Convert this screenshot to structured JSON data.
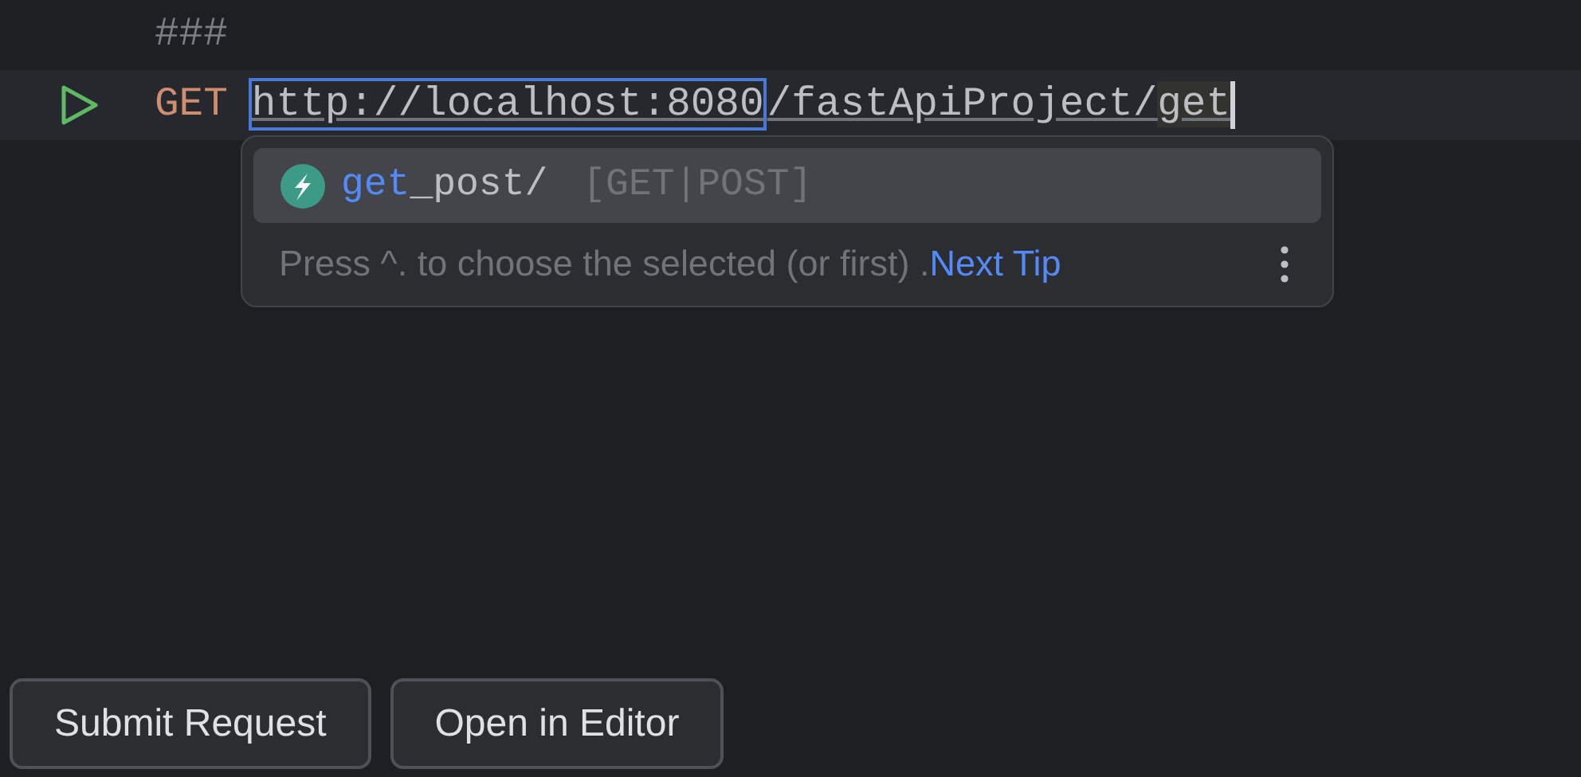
{
  "editor": {
    "lines": [
      {
        "kind": "comment",
        "text": "###",
        "current": false
      },
      {
        "kind": "request",
        "method": "GET",
        "url_host": "http://localhost:8080",
        "url_path": "/fastApiProject/",
        "typed": "get",
        "current": true
      }
    ]
  },
  "completion": {
    "items": [
      {
        "match": "get",
        "rest": "_post/",
        "methods": "[GET|POST]",
        "selected": true
      }
    ],
    "tip": {
      "text": "Press ^. to choose the selected (or first) .",
      "link": "Next Tip"
    }
  },
  "buttons": [
    "Submit Request",
    "Open in Editor"
  ]
}
